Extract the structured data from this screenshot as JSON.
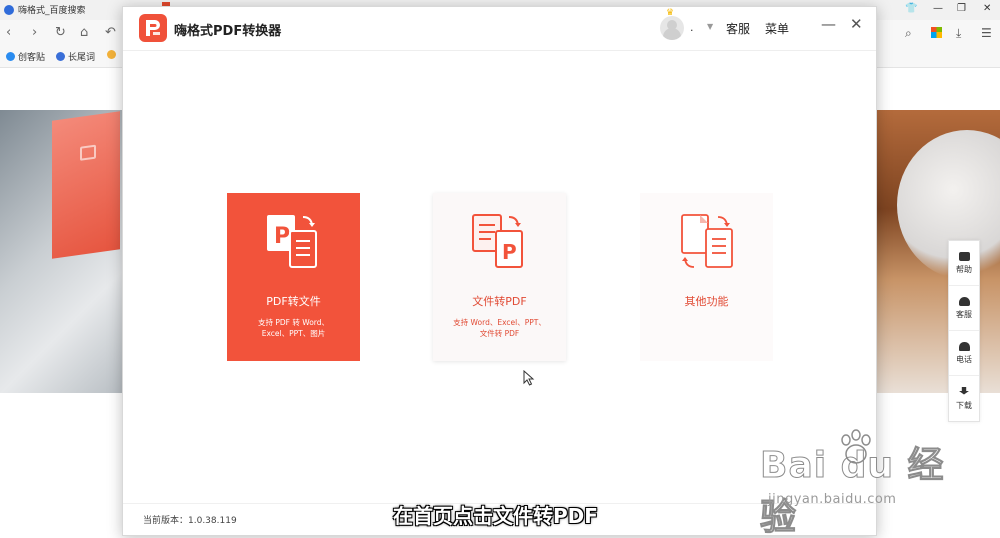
{
  "browser": {
    "tab_title": "嗨格式_百度搜索",
    "bookmarks": [
      "创客贴",
      "长尾词"
    ]
  },
  "side_panel": {
    "items": [
      {
        "label": "帮助",
        "icon": "book-icon"
      },
      {
        "label": "客服",
        "icon": "headset-icon"
      },
      {
        "label": "电话",
        "icon": "phone-icon"
      },
      {
        "label": "下载",
        "icon": "download-icon"
      }
    ]
  },
  "app": {
    "title": "嗨格式PDF转换器",
    "user_name": ".",
    "service_label": "客服",
    "menu_label": "菜单",
    "minimize_glyph": "—",
    "close_glyph": "✕",
    "cards": [
      {
        "title": "PDF转文件",
        "desc_line1": "支持 PDF 转 Word、",
        "desc_line2": "Excel、PPT、图片",
        "state": "active"
      },
      {
        "title": "文件转PDF",
        "desc_line1": "支持 Word、Excel、PPT、",
        "desc_line2": "文件转 PDF",
        "state": "hover"
      },
      {
        "title": "其他功能",
        "desc_line1": "",
        "desc_line2": "",
        "state": "normal"
      }
    ],
    "version_text": "当前版本：1.0.38.119"
  },
  "watermark": {
    "logo_text": "Bai du 经验",
    "url": "jingyan.baidu.com"
  },
  "caption": "在首页点击文件转PDF",
  "colors": {
    "brand": "#f2533b",
    "brand_text": "#e14b35"
  }
}
